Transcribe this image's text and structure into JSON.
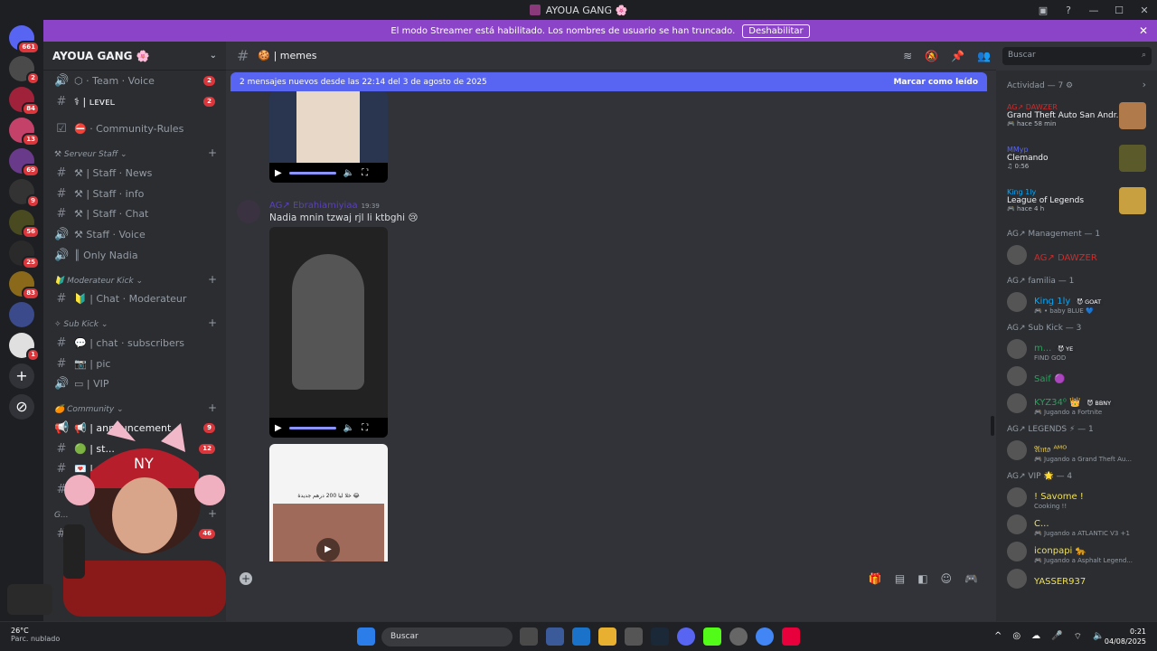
{
  "window": {
    "title": "AYOUA GANG 🌸"
  },
  "banner": {
    "text": "El modo Streamer está habilitado. Los nombres de usuario se han truncado.",
    "button": "Deshabilitar"
  },
  "servers": [
    {
      "badge": "661",
      "color": "#5865f2"
    },
    {
      "badge": "2",
      "color": "#4a4a4a"
    },
    {
      "badge": "84",
      "color": "#a0223a"
    },
    {
      "badge": "13",
      "color": "#c4426a"
    },
    {
      "badge": "69",
      "color": "#6a3a8a"
    },
    {
      "badge": "9",
      "color": "#333333"
    },
    {
      "badge": "56",
      "color": "#4a4a20"
    },
    {
      "badge": "25",
      "color": "#2a2a2a"
    },
    {
      "badge": "83",
      "color": "#8a6a1a"
    },
    {
      "badge": "",
      "color": "#3a4a8a"
    },
    {
      "badge": "1",
      "color": "#e0e0e0"
    }
  ],
  "guild": {
    "name": "AYOUA GANG 🌸"
  },
  "channels": {
    "c1": {
      "label": "⬡ · Team · Voice",
      "badge": "2"
    },
    "c2": {
      "label": "⚕ | ʟᴇᴠᴇʟ",
      "badge": "2"
    },
    "c3": {
      "label": "⛔ · Community-Rules"
    },
    "cat1": {
      "label": "⚒ Serveur Staff ⌄"
    },
    "c4": {
      "label": "⚒ | Staff · News"
    },
    "c5": {
      "label": "⚒ | Staff · info"
    },
    "c6": {
      "label": "⚒ | Staff · Chat"
    },
    "c7": {
      "label": "⚒ Staff · Voice"
    },
    "c8": {
      "label": "║ Only Nadia"
    },
    "cat2": {
      "label": "🔰 Moderateur Kick ⌄"
    },
    "c9": {
      "label": "🔰 | Chat · Moderateur"
    },
    "cat3": {
      "label": "✧ Sub Kick ⌄"
    },
    "c10": {
      "label": "💬 | chat · subscribers"
    },
    "c11": {
      "label": "📷 | pic"
    },
    "c12": {
      "label": "▭ | VIP"
    },
    "cat4": {
      "label": "🍊 Community ⌄"
    },
    "c13": {
      "label": "📢 | announcement",
      "badge": "9"
    },
    "c14": {
      "label": "🟢 | st...",
      "badge": "12"
    },
    "c15": {
      "label": "💌 | ...",
      "badge": ""
    },
    "c16": {
      "label": "🎁 | ...",
      "badge": "7"
    },
    "c17": {
      "label": "G...",
      "badge": "46"
    }
  },
  "chat": {
    "channel": "🍪 | memes",
    "new_messages": "2 mensajes nuevos desde las 22:14 del 3 de agosto de 2025",
    "mark_read": "Marcar como leído",
    "author": "AG↗ Ebrahiamiyiaa",
    "time": "19:39",
    "text": "Nadia mnin tzwaj rjl li ktbghi 😢",
    "meme_text": "خلا ليا 200 درهم جديدة 😂"
  },
  "search": {
    "placeholder": "Buscar"
  },
  "members": {
    "activity_header": "Actividad — 7 ⚙",
    "activities": [
      {
        "name": "AG↗ DAWZER",
        "name_color": "#d12a2a",
        "game": "Grand Theft Auto San Andr...",
        "sub": "🎮 hace 58 min",
        "img_color": "#b07a4a"
      },
      {
        "name": "MMyp",
        "name_color": "#5865f2",
        "game": "Clemando",
        "sub": "♫ 0:56",
        "img_color": "#5a5a2a"
      },
      {
        "name": "King 1ly",
        "name_color": "#00a8fc",
        "game": "League of Legends",
        "sub": "🎮 hace 4 h",
        "img_color": "#c8a040"
      }
    ],
    "groups": [
      {
        "header": "AG↗ Management — 1",
        "members": [
          {
            "name": "AG↗ DAWZER",
            "color": "#d12a2a",
            "tag": "",
            "sub": ""
          }
        ]
      },
      {
        "header": "AG↗ familia — 1",
        "members": [
          {
            "name": "King 1ly",
            "color": "#00a8fc",
            "tag": "😈 GOAT",
            "sub": "🎮 • baby BLUE 💙"
          }
        ]
      },
      {
        "header": "AG↗ Sub Kick — 3",
        "members": [
          {
            "name": "m...",
            "color": "#23a559",
            "tag": "😈 YE",
            "sub": "FIND GOD"
          },
          {
            "name": "Saif 🟣",
            "color": "#23a559",
            "tag": "",
            "sub": ""
          },
          {
            "name": "KYZ34⁰ 👑",
            "color": "#23a559",
            "tag": "😈 BBNY",
            "sub": "🎮 Jugando a Fortnite"
          }
        ]
      },
      {
        "header": "AG↗ LEGENDS ⚡ — 1",
        "members": [
          {
            "name": "𝔄𝔪𝔬 ᴬᴹᴼ",
            "color": "#f0d050",
            "tag": "",
            "sub": "🎮 Jugando a Grand Theft Au..."
          }
        ]
      },
      {
        "header": "AG↗ VIP 🌟 — 4",
        "members": [
          {
            "name": "! Savome !",
            "color": "#f0e050",
            "tag": "",
            "sub": "Cooking !!"
          },
          {
            "name": "C...",
            "color": "#f0e050",
            "tag": "",
            "sub": "🎮 Jugando a ATLANTIC V3 +1"
          },
          {
            "name": "iconpapi 🐆",
            "color": "#f0e050",
            "tag": "",
            "sub": "🎮 Jugando a Asphalt Legend..."
          },
          {
            "name": "YASSER937",
            "color": "#f0e050",
            "tag": "",
            "sub": ""
          }
        ]
      }
    ]
  },
  "taskbar": {
    "temp": "26°C",
    "weather": "Parc. nublado",
    "search": "Buscar",
    "time": "0:21",
    "date": "04/08/2025"
  }
}
